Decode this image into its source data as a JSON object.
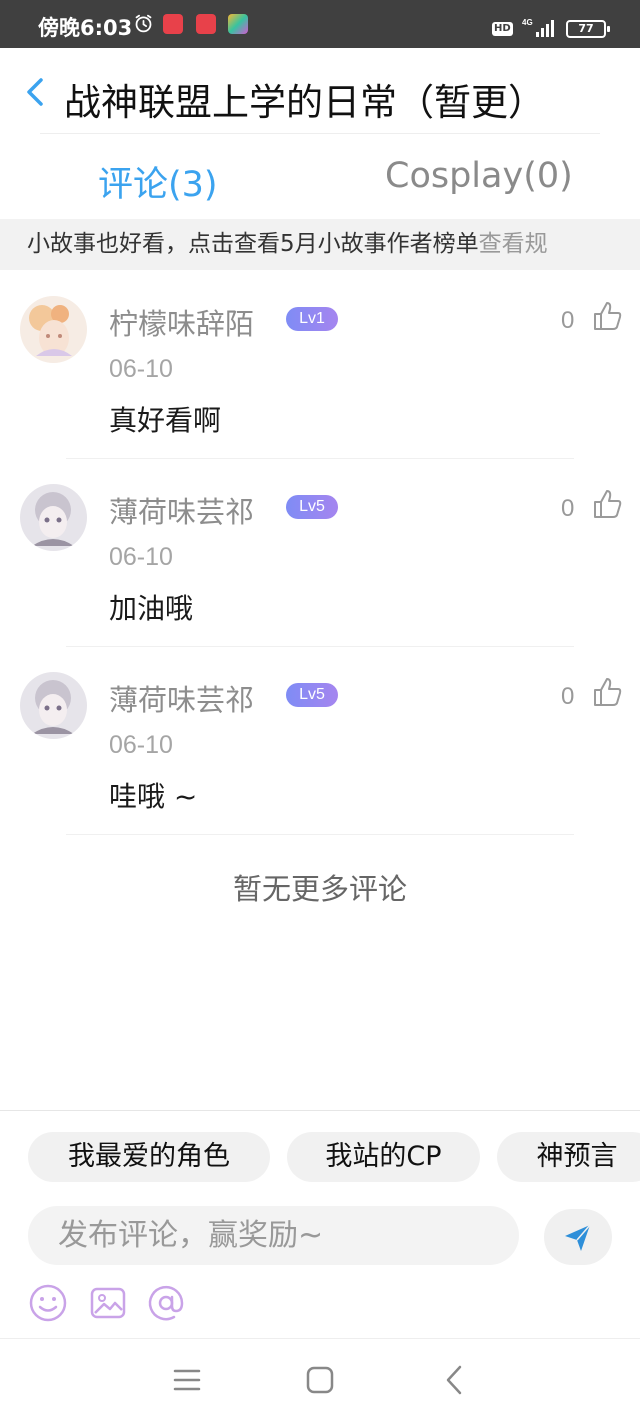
{
  "status_bar": {
    "time": "傍晚6:03",
    "network_badge": "HD",
    "network_type": "4G",
    "battery": "77",
    "app_icons": [
      "app-icon-1",
      "app-icon-2",
      "game-icon"
    ]
  },
  "header": {
    "title": "战神联盟上学的日常（暂更）",
    "back_icon": "chevron-left-icon"
  },
  "tabs": [
    {
      "label": "评论(3)",
      "active": true
    },
    {
      "label": "Cosplay(0)",
      "active": false
    }
  ],
  "notice": {
    "text": "小故事也好看，点击查看5月小故事作者榜单",
    "link": "查看规"
  },
  "comments": [
    {
      "username": "柠檬味辞陌",
      "level": "Lv1",
      "date": "06-10",
      "text": "真好看啊",
      "likes": "0"
    },
    {
      "username": "薄荷味芸祁",
      "level": "Lv5",
      "date": "06-10",
      "text": "加油哦",
      "likes": "0"
    },
    {
      "username": "薄荷味芸祁",
      "level": "Lv5",
      "date": "06-10",
      "text": "哇哦 ~",
      "likes": "0"
    }
  ],
  "no_more": "暂无更多评论",
  "composer": {
    "quick_tags": [
      "我最爱的角色",
      "我站的CP",
      "神预言"
    ],
    "placeholder": "发布评论，赢奖励~",
    "tools": [
      "emoji-icon",
      "image-icon",
      "mention-icon"
    ]
  },
  "colors": {
    "accent": "#3ba3ef",
    "level_badge": "#8f89f2",
    "tool_icon": "#c9a3e8"
  }
}
